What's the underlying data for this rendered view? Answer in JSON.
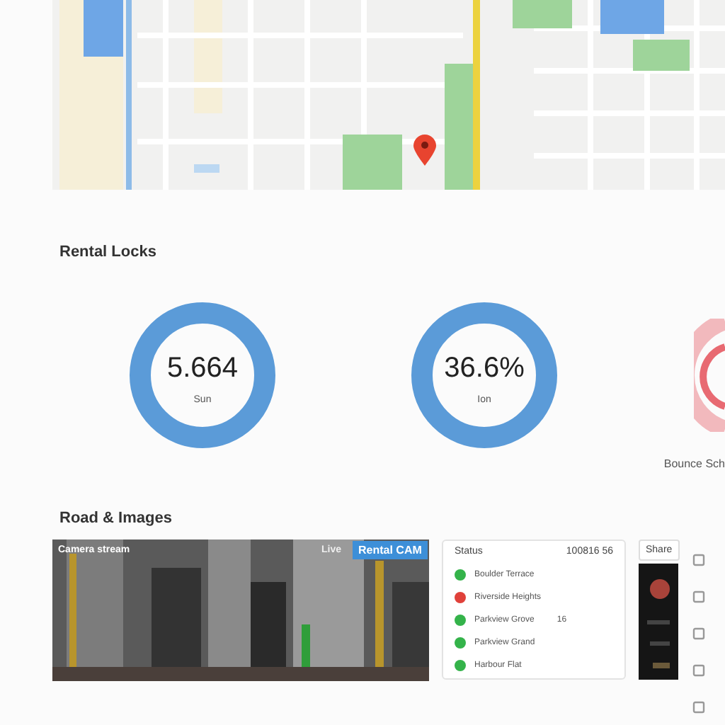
{
  "rental_section": {
    "title": "Rental Locks",
    "stats": [
      {
        "value": "5.664",
        "caption": "Sun",
        "kind": "full"
      },
      {
        "value": "36.6%",
        "caption": "Ion",
        "kind": "full"
      },
      {
        "caption": "Bounce Sch",
        "kind": "partial"
      }
    ]
  },
  "media_section": {
    "title": "Road & Images",
    "feed": {
      "caption": "Camera stream",
      "badge_label": "Live",
      "badge": "Rental CAM"
    },
    "status_list": {
      "header": "Status",
      "header_value": "100816 56",
      "items": [
        {
          "label": "Boulder Terrace",
          "color": "#34b34a"
        },
        {
          "label": "Riverside Heights",
          "color": "#e0413a"
        },
        {
          "label": "Parkview Grove",
          "color": "#34b34a",
          "note": "16"
        },
        {
          "label": "Parkview Grand",
          "color": "#34b34a"
        },
        {
          "label": "Harbour Flat",
          "color": "#34b34a"
        }
      ]
    },
    "share_button": "Share"
  }
}
